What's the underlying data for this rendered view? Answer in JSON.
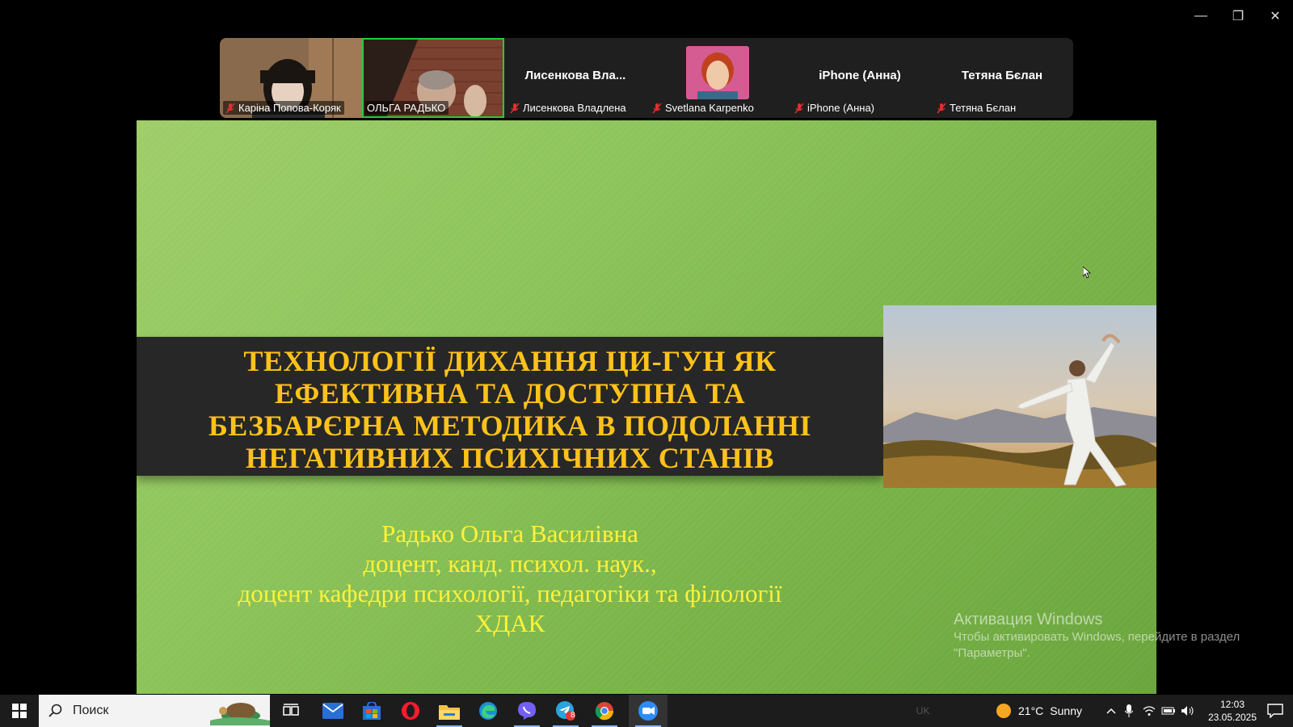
{
  "window": {
    "controls": {
      "minimize": "—",
      "restore": "❐",
      "close": "✕"
    }
  },
  "participants": [
    {
      "video_label": "Каріна Попова-Коряк",
      "muted": true,
      "has_video": true
    },
    {
      "video_label": "ОЛЬГА РАДЬКО",
      "muted": false,
      "has_video": true,
      "active": true
    },
    {
      "display_name": "Лисенкова  Вла...",
      "video_label": "Лисенкова Владлена",
      "muted": true,
      "has_video": false
    },
    {
      "video_label": "Svetlana Karpenko",
      "muted": true,
      "has_video": false,
      "has_avatar": true
    },
    {
      "display_name": "iPhone (Анна)",
      "video_label": "iPhone (Анна)",
      "muted": true,
      "has_video": false
    },
    {
      "display_name": "Тетяна Бєлан",
      "video_label": "Тетяна Бєлан",
      "muted": true,
      "has_video": false
    }
  ],
  "slide": {
    "title_lines": [
      "ТЕХНОЛОГІЇ ДИХАННЯ ЦИ-ГУН ЯК",
      "ЕФЕКТИВНА ТА ДОСТУПНА ТА",
      "БЕЗБАРЄРНА МЕТОДИКА В ПОДОЛАННІ",
      "НЕГАТИВНИХ ПСИХІЧНИХ СТАНІВ"
    ],
    "author_lines": [
      "Радько Ольга Василівна",
      "доцент, канд. психол. наук.,",
      "доцент кафедри психології, педагогіки та філології",
      "ХДАК"
    ]
  },
  "watermark": {
    "heading": "Активация Windows",
    "line1": "Чтобы активировать Windows, перейдите в раздел",
    "line2": "\"Параметры\"."
  },
  "taskbar": {
    "search_placeholder": "Поиск",
    "apps": [
      "start-icon",
      "task-view-icon",
      "mail-icon",
      "store-icon",
      "opera-icon",
      "explorer-icon",
      "edge-icon",
      "viber-icon",
      "telegram-icon",
      "chrome-icon",
      "zoom-icon"
    ],
    "telegram_badge": "8",
    "language": "UK",
    "weather": {
      "temp": "21°C",
      "condition": "Sunny"
    },
    "time": "12:03",
    "date": "23.05.2025"
  },
  "colors": {
    "title": "#ffc21a",
    "author": "#fff23a",
    "active_border": "#27c93f"
  }
}
